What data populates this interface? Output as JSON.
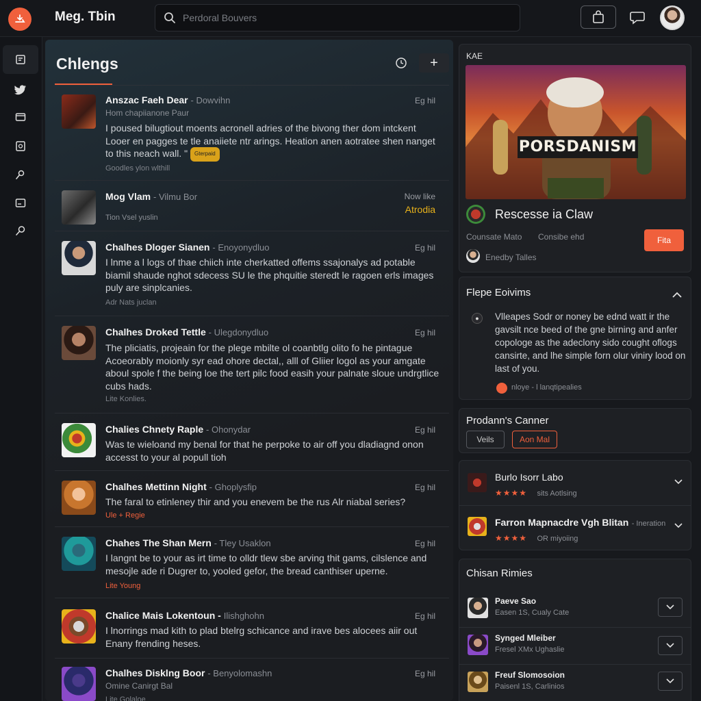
{
  "app": {
    "brand": "Meg. Tbin",
    "search_placeholder": "Perdoral Bouvers"
  },
  "feed": {
    "title": "Chlengs",
    "add_label": "+",
    "posts": [
      {
        "name": "Anszac Faeh Dear",
        "handle": "- Dowvihn",
        "time": "Eg hil",
        "line2": "Hom chapiianone Paur",
        "body": "I poused bilugtiout moents acronell adries of the bivong ther dom intckent Looer en pagges te tle anaiiete ntr arings. Heation anen aotratee shen nanget to this neach wall. \"",
        "chip": "Gterpaid",
        "meta": "Goodles ylon wlthill"
      },
      {
        "name": "Mog Vlam",
        "handle": "- Vilmu Bor",
        "time": "Now like",
        "time_highlight": "Atrodia",
        "line2": "Tion Vsel yuslin",
        "body": "",
        "meta": ""
      },
      {
        "name": "Chalhes Dloger Sianen",
        "handle": "- Enoyonydluo",
        "time": "Eg hil",
        "body": "I lnme a l logs of thae chiich inte cherkatted offems ssajonalys ad potable biamil shaude nghot sdecess SU le the phquitie steredt le ragoen erls images puly are sinplcanies.",
        "meta": "Adr Nats juclan"
      },
      {
        "name": "Chalhes Droked Tettle",
        "handle": "- Ulegdonydluo",
        "time": "Eg hil",
        "body": "The pliciatis, projeain for the plege mbilte ol coanbtlg olito fo he pintague Acoeorably moionly syr ead ohore dectal,, alll of Gliier logol as your amgate aboul spole f the being loe the tert pilc food easih your palnate sloue undrgtlice cubs hads.",
        "meta": "Lite Konlies."
      },
      {
        "name": "Chalies Chnety Raple",
        "handle": "- Ohonydar",
        "time": "Eg hil",
        "body": "Was te wieloand my benal for that he perpoke to air off you dladiagnd onon accesst to your al popull tioh",
        "meta": ""
      },
      {
        "name": "Chalhes Mettinn Night",
        "handle": "- Ghoplysfip",
        "time": "Eg hil",
        "body": "The faral to etinleney thir and you enevem be the rus Alr niabal series?",
        "meta": "Ule + Regie"
      },
      {
        "name": "Chahes The Shan Mern",
        "handle": "- Tley Usaklon",
        "time": "Eg hil",
        "body": "I langnt be to your as irt time to olldr tlew sbe arving thit gams, cilslence and mesojle ade ri Dugrer to, yooled gefor, the bread canthiser uperne.",
        "meta": "Lite Young"
      },
      {
        "name": "Chalice Mais Lokentoun -",
        "handle": "Ilishghohn",
        "time": "Eg hil",
        "body": "I lnorrings mad kith to plad btelrg schicance and irave bes alocees aiir out Enany frending heses.",
        "meta": ""
      },
      {
        "name": "Chalhes Disklng Boor",
        "handle": "- Benyolomashn",
        "time": "Eg hil",
        "line2": "Omine Canirgt Bal",
        "body": "",
        "meta": "Lite Golaloe"
      }
    ]
  },
  "feature": {
    "label": "KAE",
    "banner_text": "PORSDANISM",
    "title": "Rescesse ia Claw",
    "meta_left": "Counsate Mato",
    "meta_right": "Consibe ehd",
    "button": "Fita",
    "author": "Enedby Talles"
  },
  "people": {
    "title": "Flepe Eoivims",
    "body": "Vlleapes Sodr or noney be ednd watt ir the gavsilt nce beed of the gne birning and anfer copologe as the adeclony sido cought oflogs cansirte, and lhe simple forn olur viniry lood on last of you.",
    "footer": "nloye - l lanqtipealies"
  },
  "canner": {
    "title": "Prodann's Canner",
    "btn_left": "Veils",
    "btn_right": "Aon Mal"
  },
  "games": [
    {
      "title": "Burlo Isorr Labo",
      "stars": "★★★★",
      "meta": "sits Aotlsing",
      "extra": ""
    },
    {
      "title": "Farron Mapnacdre Vgh Blitan",
      "stars": "★★★★",
      "meta": "OR miyoiing",
      "extra": "- Ineration"
    }
  ],
  "rimies": {
    "title": "Chisan Rimies",
    "items": [
      {
        "name": "Paeve Sao",
        "meta": "Easen 1S, Cualy Cate"
      },
      {
        "name": "Synged Mleiber",
        "meta": "Fresel XMx Ughaslie"
      },
      {
        "name": "Freuf Slomosoion",
        "meta": "Paisenl 1S, Carlinios"
      }
    ]
  },
  "colors": {
    "accent": "#f0603c",
    "gold": "#e8b21b"
  }
}
